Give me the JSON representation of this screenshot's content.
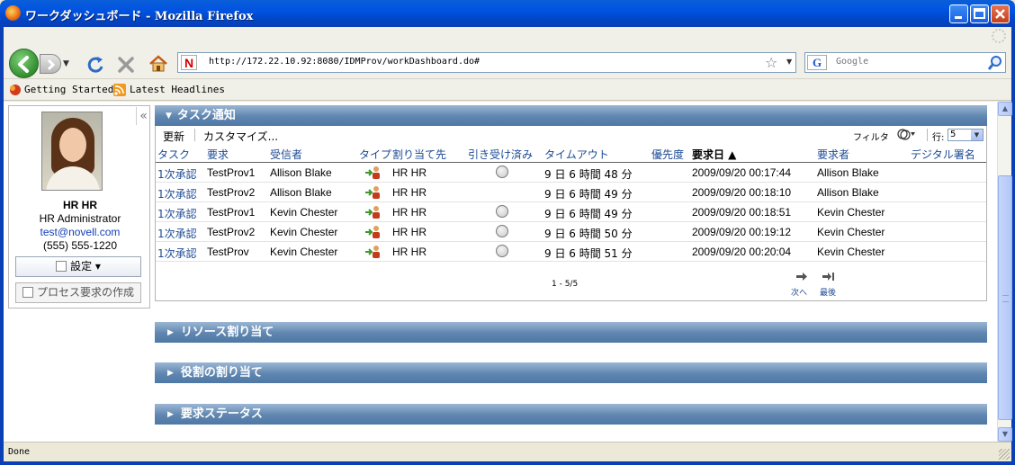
{
  "window": {
    "title": "ワークダッシュボード - Mozilla Firefox",
    "minimize": "minimize",
    "maximize": "maximize",
    "close": "close"
  },
  "toolbar": {
    "url": "http://172.22.10.92:8080/IDMProv/workDashboard.do#",
    "search_placeholder": "Google",
    "search_engine_letter": "G",
    "site_letter": "N"
  },
  "bookmarks": [
    {
      "label": "Getting Started",
      "icon": "firefox-bookmark-icon"
    },
    {
      "label": "Latest Headlines",
      "icon": "rss-icon"
    }
  ],
  "profile": {
    "name": "HR HR",
    "role": "HR Administrator",
    "email": "test@novell.com",
    "phone": "(555) 555-1220",
    "settings_label": "設定 ▾",
    "create_request_label": "プロセス要求の作成"
  },
  "task_panel": {
    "title": "タスク通知",
    "refresh": "更新",
    "customize": "カスタマイズ...",
    "filter": "フィルタ",
    "rows_label": "行:",
    "rows_value": "5",
    "columns": [
      "タスク",
      "要求",
      "受信者",
      "タイプ",
      "割り当て先",
      "引き受け済み",
      "タイムアウト",
      "優先度",
      "要求日 ▲",
      "要求者",
      "デジタル署名"
    ],
    "rows": [
      {
        "task": "1次承認",
        "request": "TestProv1",
        "recipient": "Allison Blake",
        "assigned_to": "HR HR",
        "claimed": true,
        "timeout": "9 日 6 時間 48 分",
        "priority": "",
        "date": "2009/09/20 00:17:44",
        "requester": "Allison Blake"
      },
      {
        "task": "1次承認",
        "request": "TestProv2",
        "recipient": "Allison Blake",
        "assigned_to": "HR HR",
        "claimed": false,
        "timeout": "9 日 6 時間 49 分",
        "priority": "",
        "date": "2009/09/20 00:18:10",
        "requester": "Allison Blake"
      },
      {
        "task": "1次承認",
        "request": "TestProv1",
        "recipient": "Kevin Chester",
        "assigned_to": "HR HR",
        "claimed": true,
        "timeout": "9 日 6 時間 49 分",
        "priority": "",
        "date": "2009/09/20 00:18:51",
        "requester": "Kevin Chester"
      },
      {
        "task": "1次承認",
        "request": "TestProv2",
        "recipient": "Kevin Chester",
        "assigned_to": "HR HR",
        "claimed": true,
        "timeout": "9 日 6 時間 50 分",
        "priority": "",
        "date": "2009/09/20 00:19:12",
        "requester": "Kevin Chester"
      },
      {
        "task": "1次承認",
        "request": "TestProv",
        "recipient": "Kevin Chester",
        "assigned_to": "HR HR",
        "claimed": true,
        "timeout": "9 日 6 時間 51 分",
        "priority": "",
        "date": "2009/09/20 00:20:04",
        "requester": "Kevin Chester"
      }
    ],
    "pager": "1 - 5/5",
    "next": "次へ",
    "last": "最後"
  },
  "sections": [
    {
      "title": "リソース割り当て"
    },
    {
      "title": "役割の割り当て"
    },
    {
      "title": "要求ステータス"
    }
  ],
  "status": "Done",
  "colors": {
    "panel_header": "#5f86b0",
    "link": "#1c4a94",
    "titlebar": "#0053e1"
  }
}
